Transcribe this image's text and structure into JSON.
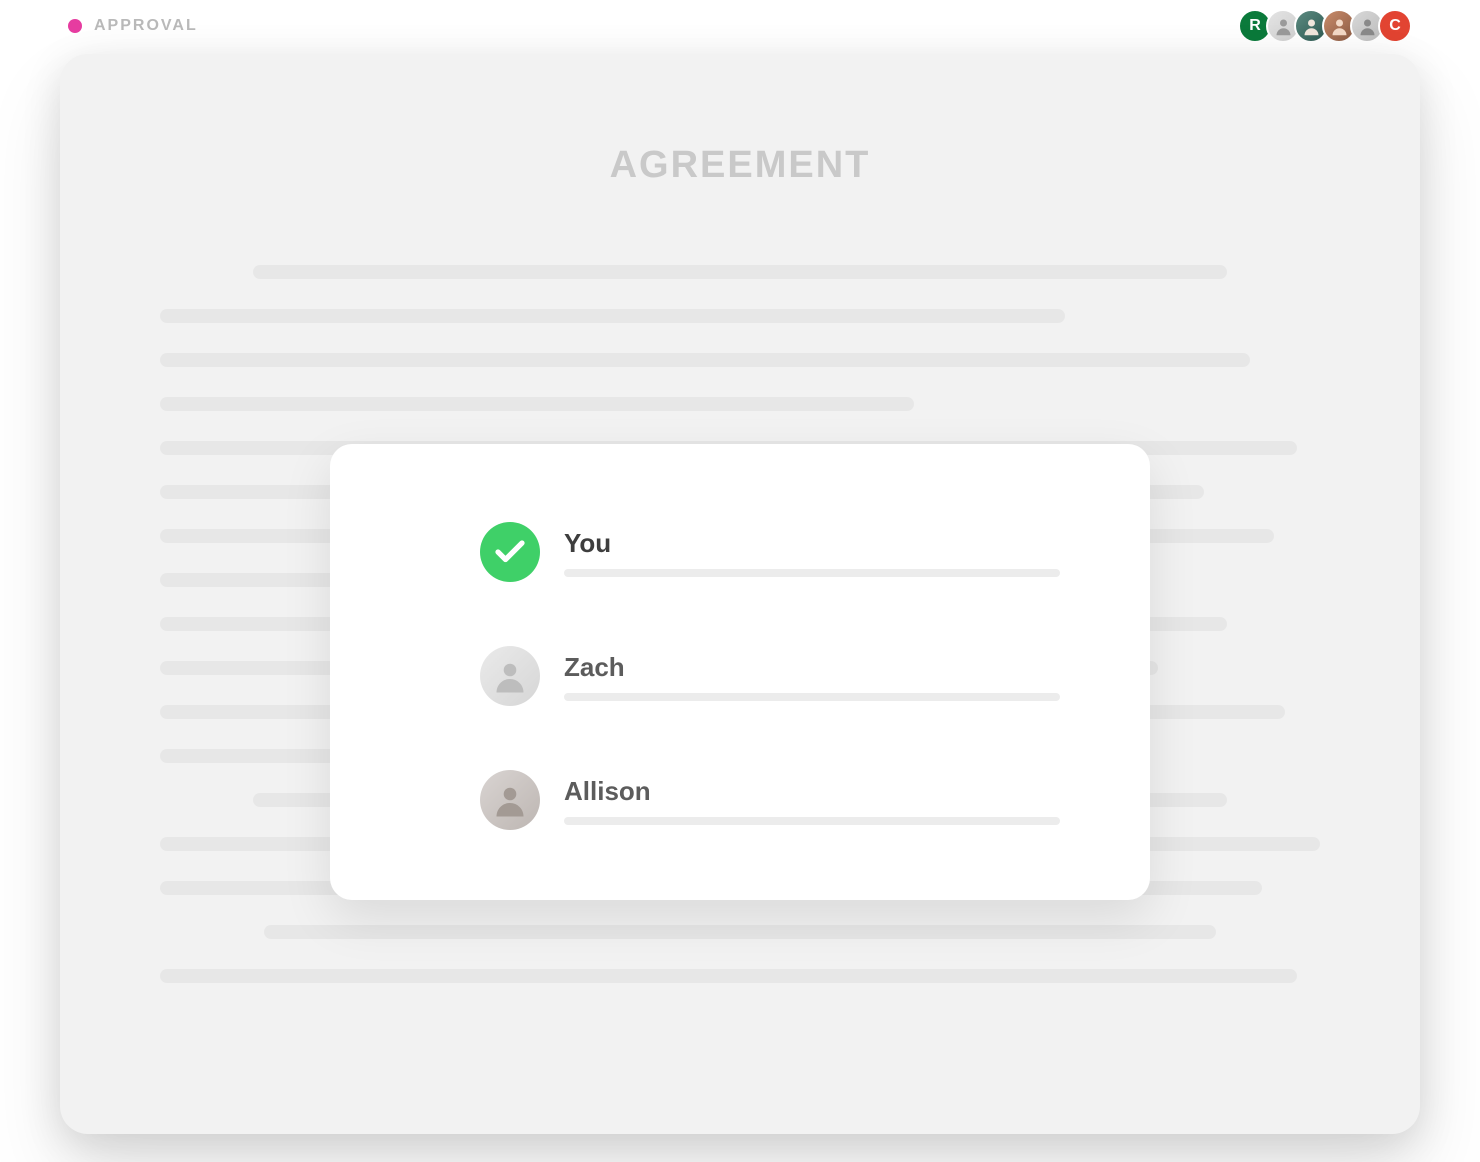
{
  "header": {
    "status_label": "APPROVAL",
    "status_color": "#e63ca0",
    "avatars": [
      {
        "type": "initial",
        "initial": "R",
        "color": "#0b7a3b"
      },
      {
        "type": "photo"
      },
      {
        "type": "photo"
      },
      {
        "type": "photo"
      },
      {
        "type": "photo"
      },
      {
        "type": "initial",
        "initial": "C",
        "color": "#e24432"
      }
    ]
  },
  "document": {
    "title": "AGREEMENT"
  },
  "approvers": [
    {
      "name": "You",
      "status": "approved"
    },
    {
      "name": "Zach",
      "status": "pending"
    },
    {
      "name": "Allison",
      "status": "pending"
    }
  ],
  "colors": {
    "approved": "#3fd068",
    "skeleton": "#e7e7e7"
  }
}
